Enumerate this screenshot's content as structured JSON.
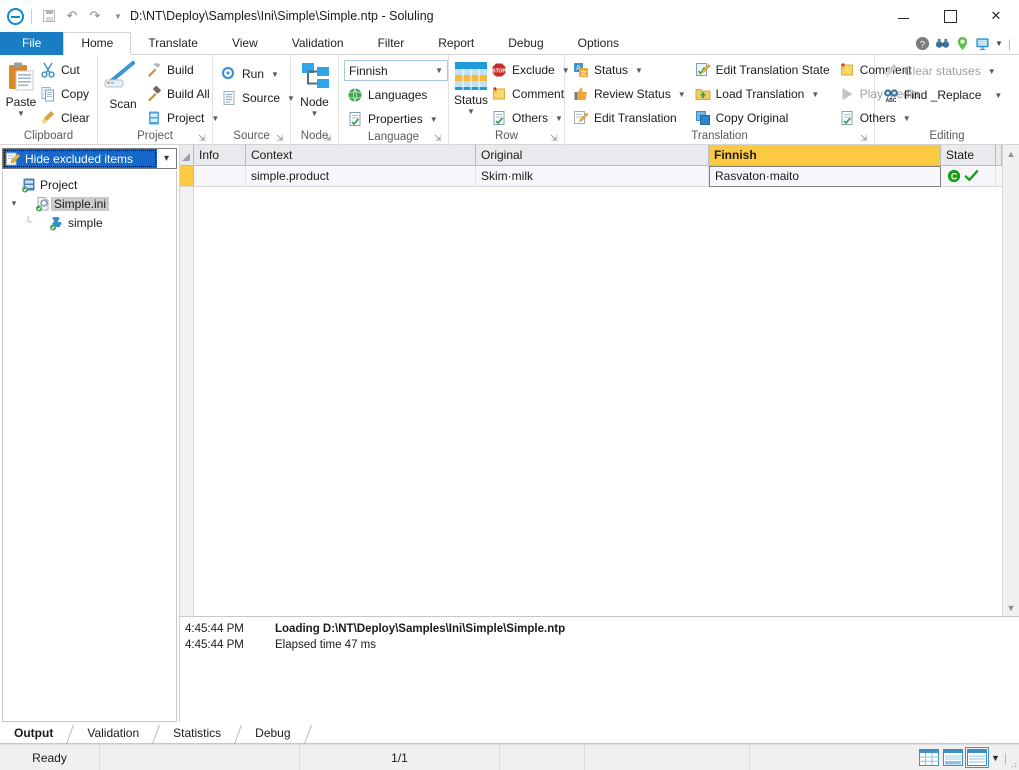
{
  "window": {
    "title": "D:\\NT\\Deploy\\Samples\\Ini\\Simple\\Simple.ntp  -  Soluling",
    "app_icon": "soluling-logo-icon",
    "quick_access": [
      "save-icon",
      "undo-icon",
      "redo-icon",
      "customize-qat-icon"
    ],
    "controls": {
      "minimize": "—",
      "maximize": "□",
      "close": "✕"
    }
  },
  "ribbon": {
    "tabs": [
      "File",
      "Home",
      "Translate",
      "View",
      "Validation",
      "Filter",
      "Report",
      "Debug",
      "Options"
    ],
    "active_tab": "Home",
    "help_icons": [
      "help-icon",
      "binoculars-icon",
      "location-pin-icon",
      "monitor-icon",
      "ribbon-options-icon"
    ],
    "groups": [
      {
        "title": "Clipboard",
        "has_launcher": false,
        "big": {
          "label": "Paste",
          "icon": "paste-icon",
          "has_menu": true
        },
        "items": [
          {
            "label": "Cut",
            "icon": "cut-icon",
            "has_menu": false,
            "disabled": false
          },
          {
            "label": "Copy",
            "icon": "copy-icon",
            "has_menu": false,
            "disabled": false
          },
          {
            "label": "Clear",
            "icon": "clear-icon",
            "has_menu": false,
            "disabled": false
          }
        ]
      },
      {
        "title": "Project",
        "has_launcher": true,
        "big": {
          "label": "Scan",
          "icon": "scan-icon",
          "has_menu": false
        },
        "items": [
          {
            "label": "Build",
            "icon": "build-icon",
            "has_menu": false,
            "disabled": false
          },
          {
            "label": "Build All",
            "icon": "build-all-icon",
            "has_menu": false,
            "disabled": false
          },
          {
            "label": "Project",
            "icon": "project-icon",
            "has_menu": true,
            "disabled": false
          }
        ]
      },
      {
        "title": "Source",
        "has_launcher": true,
        "items": [
          {
            "label": "Run",
            "icon": "run-icon",
            "has_menu": true,
            "disabled": false
          },
          {
            "label": "Source",
            "icon": "source-icon",
            "has_menu": true,
            "disabled": false
          }
        ]
      },
      {
        "title": "Node",
        "has_launcher": true,
        "big": {
          "label": "Node",
          "icon": "node-tree-icon",
          "has_menu": true
        }
      },
      {
        "title": "Language",
        "has_launcher": true,
        "language_value": "Finnish",
        "items": [
          {
            "label": "Languages",
            "icon": "globe-icon",
            "has_menu": false,
            "disabled": false
          },
          {
            "label": "Properties",
            "icon": "properties-icon",
            "has_menu": true,
            "disabled": false
          }
        ]
      },
      {
        "title": "Row",
        "has_launcher": true,
        "big": {
          "label": "Status",
          "icon": "status-grid-icon",
          "has_menu": true
        },
        "items": [
          {
            "label": "Exclude",
            "icon": "exclude-icon",
            "has_menu": true,
            "disabled": false
          },
          {
            "label": "Comment",
            "icon": "comment-icon",
            "has_menu": false,
            "disabled": false
          },
          {
            "label": "Others",
            "icon": "others-icon",
            "has_menu": true,
            "disabled": false
          }
        ]
      },
      {
        "title": "Translation",
        "has_launcher": true,
        "col1": [
          {
            "label": "Status",
            "icon": "translation-status-icon",
            "has_menu": true,
            "disabled": false
          },
          {
            "label": "Review Status",
            "icon": "thumb-up-icon",
            "has_menu": true,
            "disabled": false
          },
          {
            "label": "Edit Translation",
            "icon": "edit-pencil-icon",
            "has_menu": false,
            "disabled": false
          }
        ],
        "col2": [
          {
            "label": "Edit Translation State",
            "icon": "edit-state-icon",
            "has_menu": false,
            "disabled": false
          },
          {
            "label": "Load Translation",
            "icon": "load-folder-icon",
            "has_menu": true,
            "disabled": false
          },
          {
            "label": "Copy Original",
            "icon": "copy-original-icon",
            "has_menu": false,
            "disabled": false
          }
        ],
        "col3": [
          {
            "label": "Comment",
            "icon": "comment-icon",
            "has_menu": false,
            "disabled": false
          },
          {
            "label": "Play Media",
            "icon": "play-icon",
            "has_menu": false,
            "disabled": true
          },
          {
            "label": "Others",
            "icon": "others-icon",
            "has_menu": true,
            "disabled": false
          }
        ]
      },
      {
        "title": "Editing",
        "has_launcher": false,
        "items": [
          {
            "label": "Clear statuses",
            "icon": "clear-statuses-icon",
            "has_menu": true,
            "disabled": true
          },
          {
            "label": "Find _Replace",
            "icon": "find-replace-icon",
            "has_menu": true,
            "disabled": false
          }
        ]
      }
    ]
  },
  "left_pane": {
    "filter_combo": {
      "value": "Hide excluded items",
      "icon": "edit-note-icon"
    },
    "tree": [
      {
        "label": "Project",
        "icon": "project-node-icon",
        "depth": 0,
        "expander": "",
        "selected": false
      },
      {
        "label": "Simple.ini",
        "icon": "file-node-icon",
        "depth": 1,
        "expander": "⌄",
        "selected": true
      },
      {
        "label": "simple",
        "icon": "puzzle-node-icon",
        "depth": 2,
        "expander": "",
        "selected": false
      }
    ]
  },
  "grid": {
    "columns": [
      "Info",
      "Context",
      "Original",
      "Finnish",
      "State"
    ],
    "selected_column": "Finnish",
    "rows": [
      {
        "info": "",
        "context": "simple.product",
        "original": "Skim·milk",
        "finnish": "Rasvaton·maito",
        "state_icons": [
          "copyright-c-icon",
          "check-mark-icon"
        ]
      }
    ]
  },
  "output": {
    "lines": [
      {
        "time": "4:45:44 PM",
        "text": "Loading D:\\NT\\Deploy\\Samples\\Ini\\Simple\\Simple.ntp",
        "bold": true
      },
      {
        "time": "4:45:44 PM",
        "text": "Elapsed time 47 ms",
        "bold": false
      }
    ],
    "tabs": [
      "Output",
      "Validation",
      "Statistics",
      "Debug"
    ],
    "active_tab": "Output"
  },
  "status_bar": {
    "ready_text": "Ready",
    "page_indicator": "1/1",
    "view_modes": [
      "grid-view-icon",
      "split-view-icon",
      "form-view-icon"
    ],
    "selected_view_mode": "form-view-icon",
    "overflow": "view-options-icon"
  },
  "colors": {
    "accent_blue": "#1a7cc2",
    "selection_blue": "#1669c8",
    "highlight_amber": "#fcc942",
    "tab_bar_bg": "#ffffff",
    "status_green": "#1aa31a"
  }
}
